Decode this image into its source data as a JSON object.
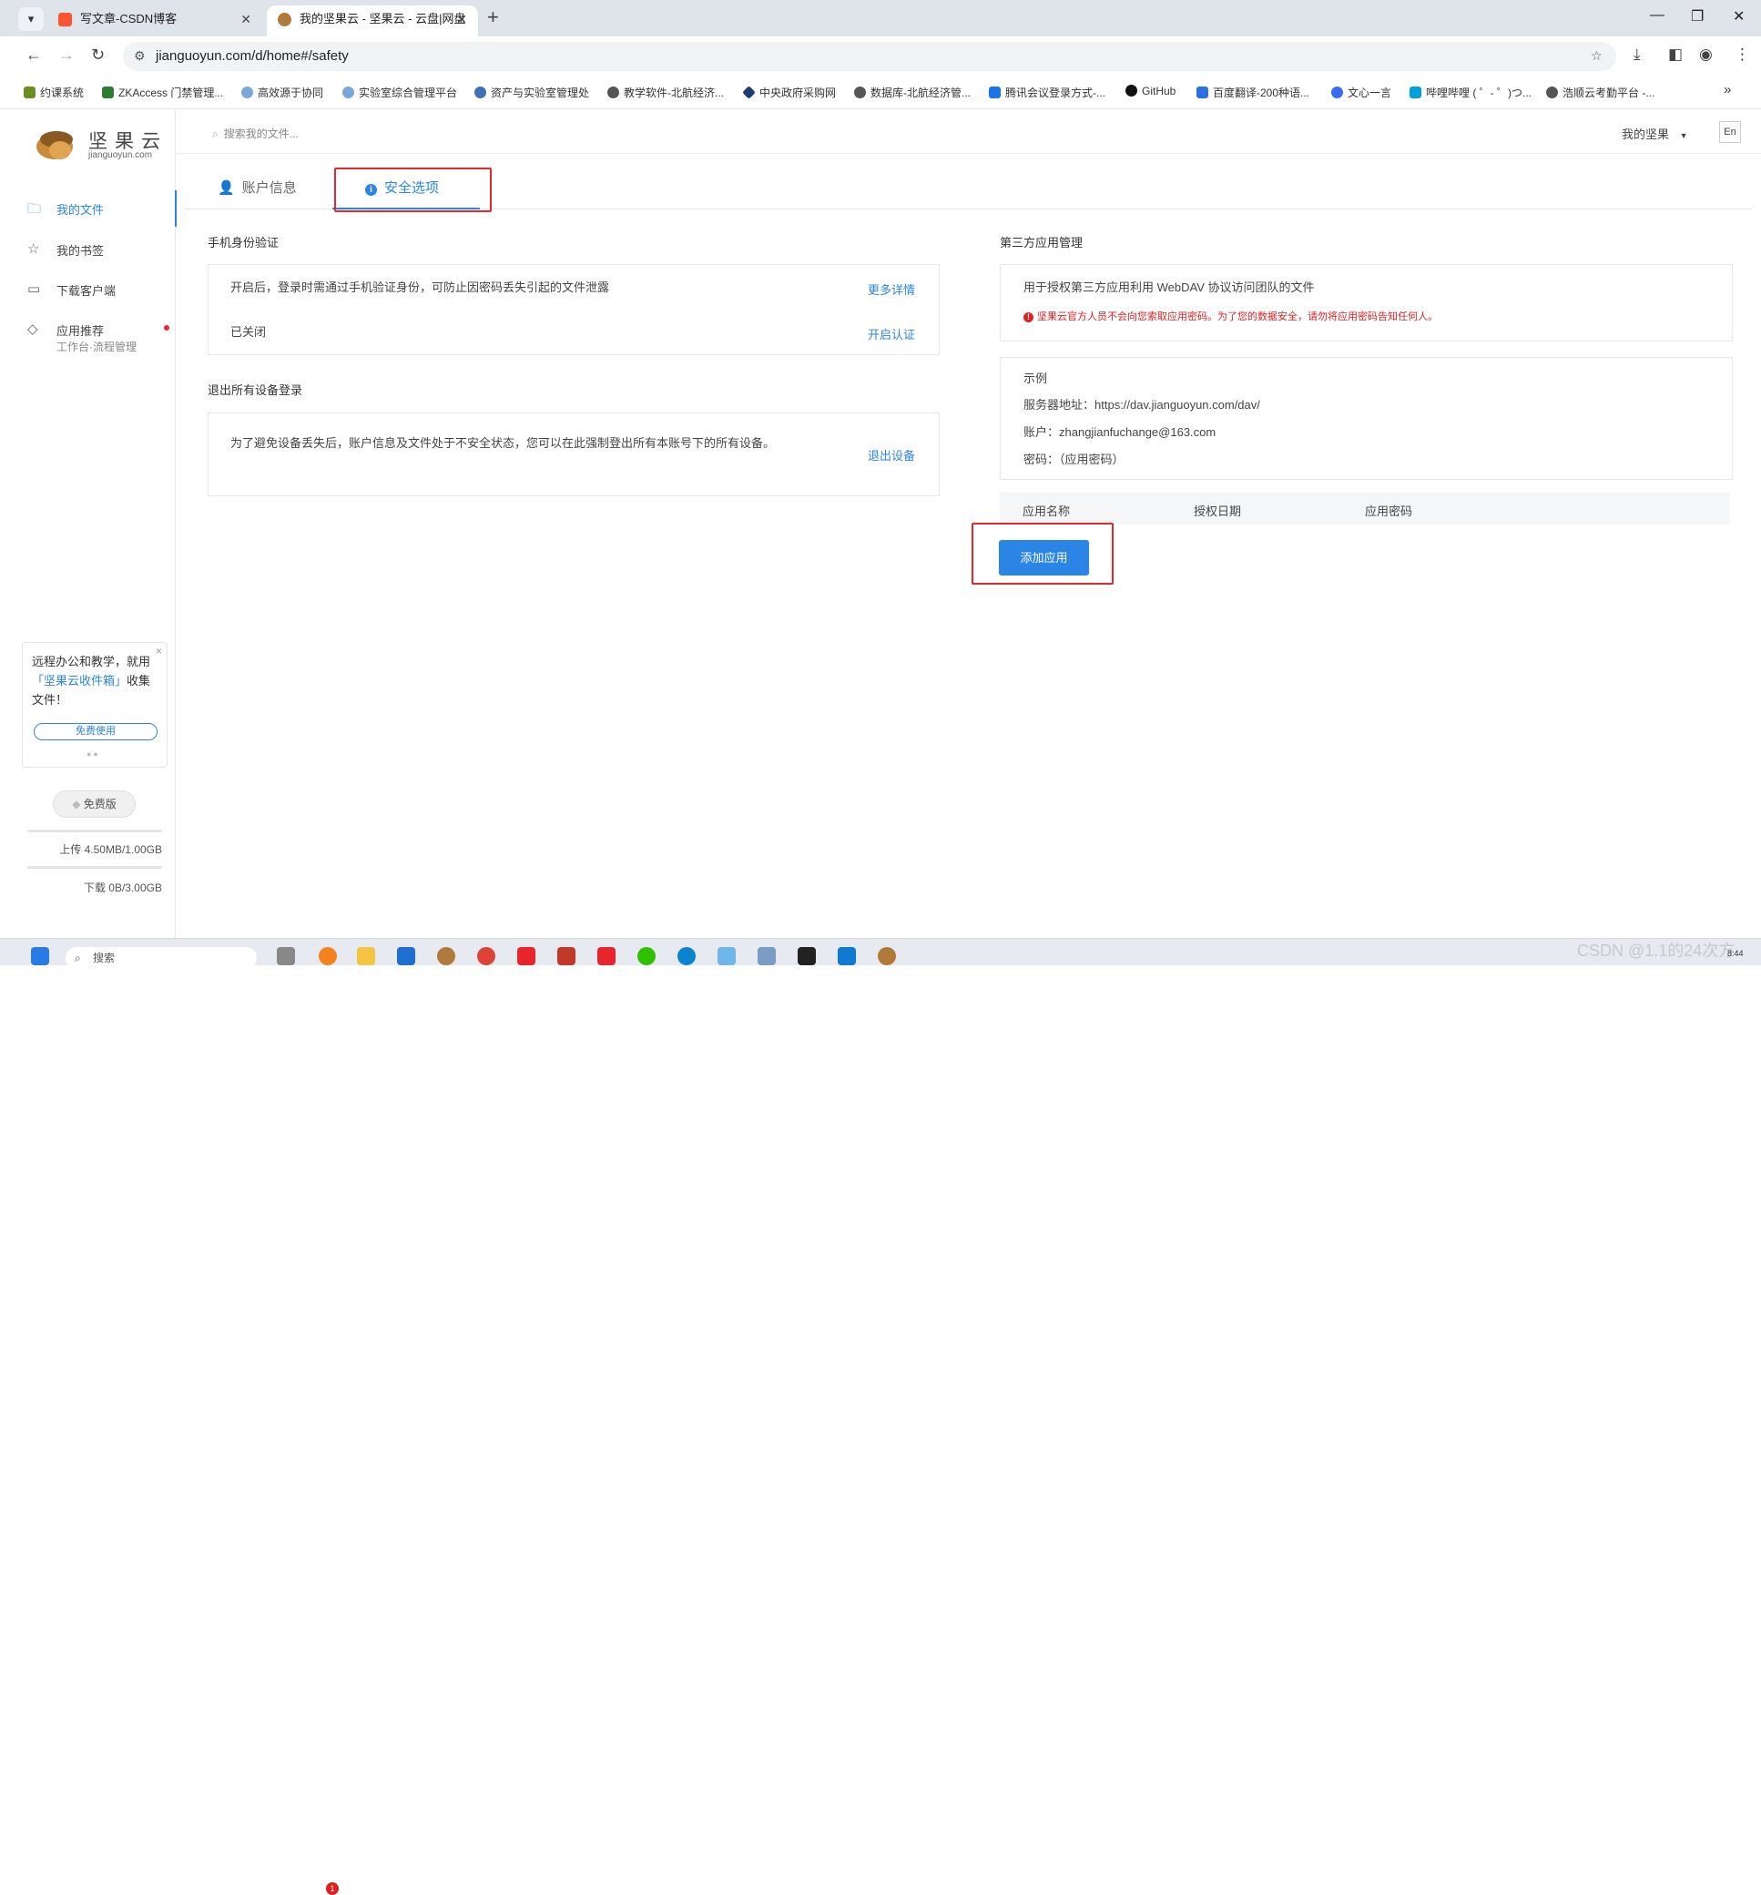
{
  "browser": {
    "tabs": [
      {
        "title": "写文章-CSDN博客",
        "active": false
      },
      {
        "title": "我的坚果云 - 坚果云 - 云盘|网盘",
        "active": true
      }
    ],
    "tab_menu_icon": "▾",
    "new_tab": "+",
    "url": "jianguoyun.com/d/home#/safety",
    "bookmarks": [
      "约课系统",
      "ZKAccess 门禁管理...",
      "高效源于协同",
      "实验室综合管理平台",
      "资产与实验室管理处",
      "教学软件-北航经济...",
      "中央政府采购网",
      "数据库-北航经济管...",
      "腾讯会议登录方式-...",
      "GitHub",
      "百度翻译-200种语...",
      "文心一言",
      "哔哩哔哩 ( ゜- ゜)つ...",
      "浩顺云考勤平台 -..."
    ],
    "more": "»"
  },
  "app": {
    "logo": {
      "name": "坚果云",
      "sub": "jianguoyun.com"
    },
    "search_placeholder": "搜索我的文件...",
    "my_nut_menu": "我的坚果",
    "lang_button": "En",
    "sidebar": [
      {
        "label": "我的文件",
        "icon": "folder-icon",
        "active": true
      },
      {
        "label": "我的书签",
        "icon": "star-icon",
        "active": false
      },
      {
        "label": "下载客户端",
        "icon": "monitor-icon",
        "active": false
      },
      {
        "label": "应用推荐",
        "sub": "工作台·流程管理",
        "icon": "tag-icon",
        "active": false
      }
    ],
    "promo": {
      "text_before": "远程办公和教学，就用",
      "highlight": "「坚果云收件箱」",
      "text_after": "收集文件！",
      "button": "免费使用",
      "close": "×"
    },
    "plan_button": "免费版",
    "quota": {
      "upload": "上传 4.50MB/1.00GB",
      "download": "下载 0B/3.00GB"
    },
    "tabs": [
      {
        "label": "账户信息",
        "icon": "user-icon",
        "active": false
      },
      {
        "label": "安全选项",
        "icon": "info-icon",
        "active": true
      }
    ],
    "phone_auth": {
      "title": "手机身份验证",
      "description": "开启后，登录时需通过手机验证身份，可防止因密码丢失引起的文件泄露",
      "more_link": "更多详情",
      "status": "已关闭",
      "enable_link": "开启认证"
    },
    "logout_devices": {
      "title": "退出所有设备登录",
      "description": "为了避免设备丢失后，账户信息及文件处于不安全状态，您可以在此强制登出所有本账号下的所有设备。",
      "link": "退出设备"
    },
    "third_party": {
      "title": "第三方应用管理",
      "description": "用于授权第三方应用利用 WebDAV 协议访问团队的文件",
      "warning": "坚果云官方人员不会向您索取应用密码。为了您的数据安全，请勿将应用密码告知任何人。",
      "example_title": "示例",
      "server_label": "服务器地址：",
      "server_value": "https://dav.jianguoyun.com/dav/",
      "account_label": "账户：",
      "account_value": "zhangjianfuchange@163.com",
      "password_label": "密码：",
      "password_value": "（应用密码）",
      "columns": [
        "应用名称",
        "授权日期",
        "应用密码"
      ],
      "add_button": "添加应用"
    }
  },
  "taskbar": {
    "search": "搜索",
    "badge": "1",
    "watermark": "CSDN @1.1的24次方",
    "clock": "8:44"
  },
  "colors": {
    "accent": "#2b85e4",
    "highlight_box": "#e8262c",
    "warning": "#e02020"
  }
}
